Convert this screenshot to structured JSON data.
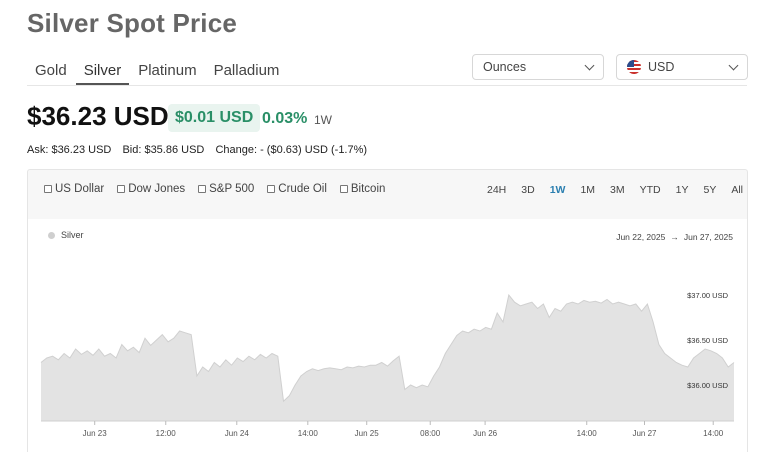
{
  "page": {
    "title": "Silver Spot Price"
  },
  "metal_tabs": [
    {
      "label": "Gold",
      "active": false
    },
    {
      "label": "Silver",
      "active": true
    },
    {
      "label": "Platinum",
      "active": false
    },
    {
      "label": "Palladium",
      "active": false
    }
  ],
  "units_select": {
    "value": "Ounces"
  },
  "currency_select": {
    "value": "USD",
    "flag_icon": "us-flag-icon"
  },
  "price": {
    "value": "$36.23 USD",
    "change_amount": "$0.01 USD",
    "change_percent": "0.03%",
    "range": "1W"
  },
  "quote": {
    "ask": "Ask: $36.23 USD",
    "bid": "Bid: $35.86 USD",
    "change": "Change: - ($0.63) USD (-1.7%)"
  },
  "compare_options": [
    {
      "label": "US Dollar",
      "checked": false
    },
    {
      "label": "Dow Jones",
      "checked": false
    },
    {
      "label": "S&P 500",
      "checked": false
    },
    {
      "label": "Crude Oil",
      "checked": false
    },
    {
      "label": "Bitcoin",
      "checked": false
    }
  ],
  "periods": [
    {
      "label": "24H",
      "active": false
    },
    {
      "label": "3D",
      "active": false
    },
    {
      "label": "1W",
      "active": true
    },
    {
      "label": "1M",
      "active": false
    },
    {
      "label": "3M",
      "active": false
    },
    {
      "label": "YTD",
      "active": false
    },
    {
      "label": "1Y",
      "active": false
    },
    {
      "label": "5Y",
      "active": false
    },
    {
      "label": "All",
      "active": false
    }
  ],
  "chart_data": {
    "type": "area",
    "date_start": "Jun 22, 2025",
    "date_arrow": "→",
    "date_end": "Jun 27, 2025",
    "legend_position": "top-left",
    "colors": {
      "fill": "#e3e3e3",
      "line": "#d0d0d0",
      "legend": "#cfcfcf"
    },
    "ylim": [
      35.6,
      37.4
    ],
    "y_ticks": [
      {
        "value": 37.0,
        "label": "$37.00 USD"
      },
      {
        "value": 36.5,
        "label": "$36.50 USD"
      },
      {
        "value": 36.0,
        "label": "$36.00 USD"
      }
    ],
    "xlim": [
      0,
      120
    ],
    "x_ticks": [
      {
        "x": 9.3,
        "label": "Jun 23"
      },
      {
        "x": 21.6,
        "label": "12:00"
      },
      {
        "x": 33.9,
        "label": "Jun 24"
      },
      {
        "x": 46.2,
        "label": "14:00"
      },
      {
        "x": 56.4,
        "label": "Jun 25"
      },
      {
        "x": 67.4,
        "label": "08:00"
      },
      {
        "x": 76.9,
        "label": "Jun 26"
      },
      {
        "x": 94.5,
        "label": "14:00"
      },
      {
        "x": 104.5,
        "label": "Jun 27"
      },
      {
        "x": 116.4,
        "label": "14:00"
      }
    ],
    "series": [
      {
        "name": "Silver",
        "x": [
          0,
          1,
          2,
          3,
          4,
          5,
          6,
          7,
          8,
          9,
          10,
          11,
          12,
          13,
          14,
          15,
          16,
          17,
          18,
          19,
          20,
          21,
          22,
          23,
          24,
          25,
          26,
          27,
          28,
          29,
          30,
          31,
          32,
          33,
          34,
          35,
          36,
          37,
          38,
          39,
          40,
          41,
          42,
          43,
          44,
          45,
          46,
          47,
          48,
          49,
          50,
          51,
          52,
          53,
          54,
          55,
          56,
          57,
          58,
          59,
          60,
          61,
          62,
          63,
          64,
          65,
          66,
          67,
          68,
          69,
          70,
          71,
          72,
          73,
          74,
          75,
          76,
          77,
          78,
          79,
          80,
          81,
          82,
          83,
          84,
          85,
          86,
          87,
          88,
          89,
          90,
          91,
          92,
          93,
          94,
          95,
          96,
          97,
          98,
          99,
          100,
          101,
          102,
          103,
          104,
          105,
          106,
          107,
          108,
          109,
          110,
          111,
          112,
          113,
          114,
          115,
          116,
          117,
          118,
          119,
          120
        ],
        "values": [
          36.25,
          36.3,
          36.32,
          36.28,
          36.35,
          36.3,
          36.4,
          36.34,
          36.38,
          36.33,
          36.4,
          36.32,
          36.35,
          36.3,
          36.45,
          36.38,
          36.42,
          36.36,
          36.52,
          36.44,
          36.5,
          36.56,
          36.48,
          36.52,
          36.6,
          36.58,
          36.56,
          36.1,
          36.2,
          36.15,
          36.25,
          36.2,
          36.28,
          36.22,
          36.3,
          36.26,
          36.32,
          36.28,
          36.34,
          36.3,
          36.35,
          36.32,
          35.82,
          35.88,
          36.0,
          36.1,
          36.15,
          36.18,
          36.16,
          36.18,
          36.19,
          36.18,
          36.17,
          36.2,
          36.19,
          36.21,
          36.2,
          36.22,
          36.22,
          36.25,
          36.21,
          36.27,
          36.32,
          35.95,
          36.0,
          35.97,
          36.0,
          35.98,
          36.1,
          36.2,
          36.35,
          36.45,
          36.55,
          36.6,
          36.58,
          36.62,
          36.6,
          36.64,
          36.62,
          36.8,
          36.7,
          37.0,
          36.92,
          36.88,
          36.9,
          36.92,
          36.85,
          36.9,
          36.75,
          36.85,
          36.82,
          36.9,
          36.92,
          36.9,
          36.94,
          36.92,
          36.93,
          36.91,
          36.95,
          36.9,
          36.92,
          36.9,
          36.88,
          36.9,
          36.82,
          36.9,
          36.7,
          36.45,
          36.35,
          36.3,
          36.25,
          36.22,
          36.2,
          36.3,
          36.35,
          36.4,
          36.38,
          36.35,
          36.3,
          36.2,
          36.25
        ]
      }
    ]
  }
}
